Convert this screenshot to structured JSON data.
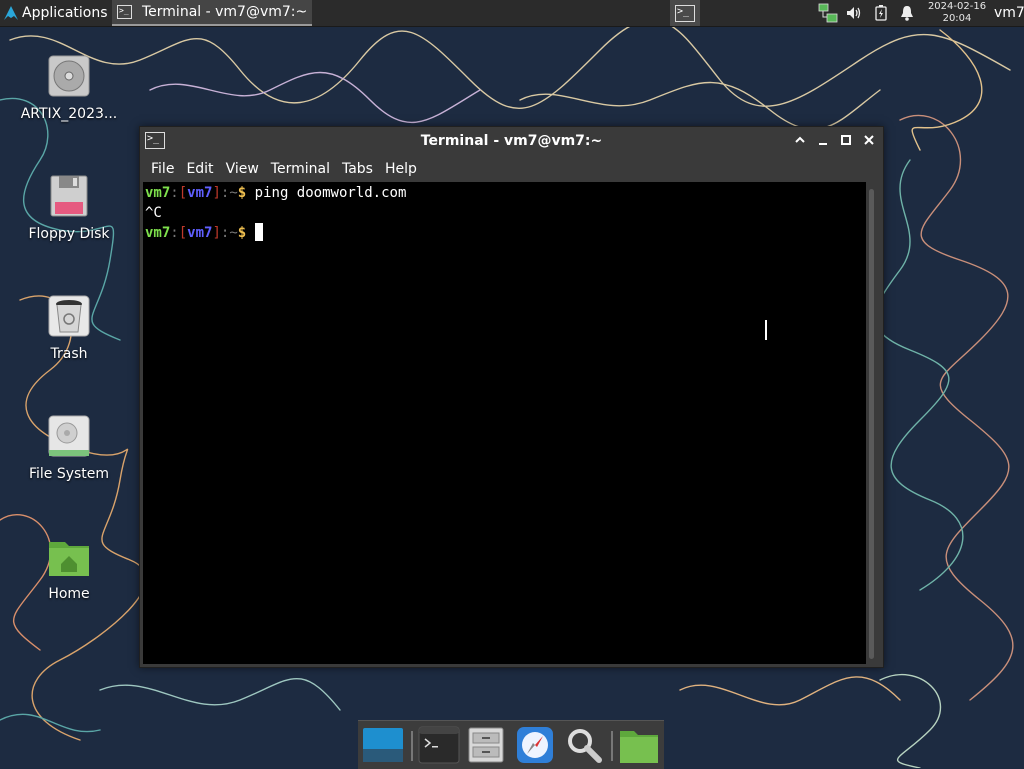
{
  "panel": {
    "applications_label": "Applications",
    "task_title": "Terminal - vm7@vm7:~",
    "clock_date": "2024-02-16",
    "clock_time": "20:04",
    "user": "vm7",
    "tray_icons": [
      "network-icon",
      "volume-icon",
      "battery-icon",
      "notification-bell-icon"
    ]
  },
  "desktop": {
    "icons": [
      {
        "name": "ARTIX_2023...",
        "icon": "disc-icon"
      },
      {
        "name": "Floppy Disk",
        "icon": "floppy-icon"
      },
      {
        "name": "Trash",
        "icon": "trash-icon"
      },
      {
        "name": "File System",
        "icon": "harddisk-icon"
      },
      {
        "name": "Home",
        "icon": "home-folder-icon"
      }
    ]
  },
  "window": {
    "title": "Terminal - vm7@vm7:~",
    "menu": [
      "File",
      "Edit",
      "View",
      "Terminal",
      "Tabs",
      "Help"
    ],
    "prompt": {
      "user": "vm7",
      "colon1": ":",
      "open": "[",
      "host": "vm7",
      "close": "]",
      "sep": ":",
      "path": "~",
      "dollar": "$"
    },
    "lines": [
      {
        "type": "prompt",
        "command": "ping doomworld.com"
      },
      {
        "type": "output",
        "text": "^C"
      },
      {
        "type": "prompt",
        "command": ""
      }
    ]
  },
  "dock": {
    "items": [
      "show-desktop-icon",
      "terminal-icon",
      "file-manager-icon",
      "web-browser-icon",
      "search-icon",
      "folder-icon"
    ]
  },
  "colors": {
    "panel": "#2b2b2b",
    "prompt_user": "#7ee04c",
    "prompt_host": "#5f5fff",
    "prompt_bracket": "#c0392b",
    "prompt_dollar": "#f0c050"
  }
}
